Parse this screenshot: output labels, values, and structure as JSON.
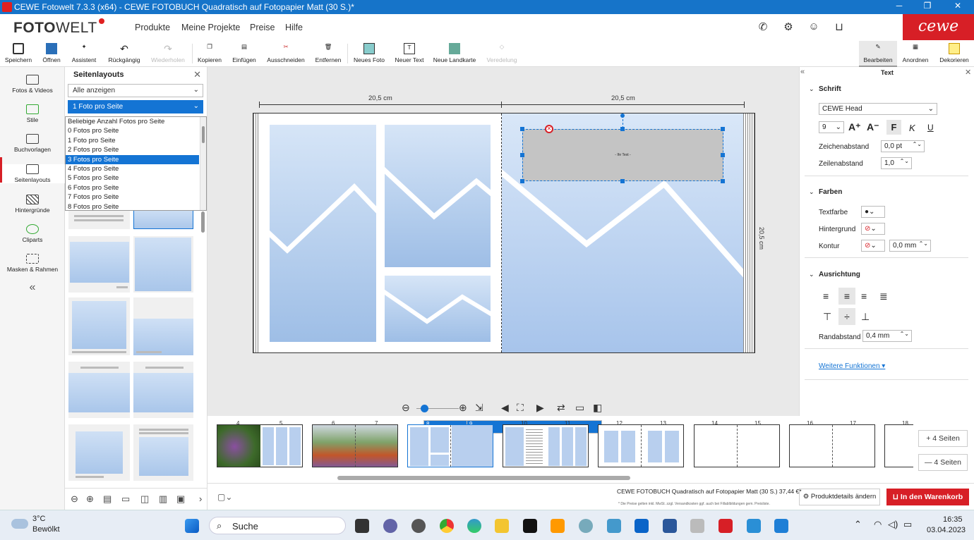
{
  "window": {
    "title": "CEWE Fotowelt 7.3.3 (x64) - CEWE FOTOBUCH Quadratisch auf Fotopapier Matt (30 S.)*"
  },
  "menubar": {
    "logo_a": "FOTO",
    "logo_b": "WELT",
    "items": [
      "Produkte",
      "Meine Projekte",
      "Preise",
      "Hilfe"
    ],
    "brand": "cewe"
  },
  "toolbar": {
    "items": [
      "Speichern",
      "Öffnen",
      "Assistent",
      "Rückgängig",
      "Wiederholen",
      "Kopieren",
      "Einfügen",
      "Ausschneiden",
      "Entfernen",
      "Neues Foto",
      "Neuer Text",
      "Neue Landkarte",
      "Veredelung"
    ],
    "right_tabs": [
      "Bearbeiten",
      "Anordnen",
      "Dekorieren"
    ]
  },
  "leftnav": [
    "Fotos & Videos",
    "Stile",
    "Buchvorlagen",
    "Seitenlayouts",
    "Hintergründe",
    "Cliparts",
    "Masken & Rahmen"
  ],
  "panel": {
    "title": "Seitenlayouts",
    "filter": "Alle anzeigen",
    "selected": "1 Foto pro Seite",
    "options": [
      "Beliebige Anzahl Fotos pro Seite",
      "0 Fotos pro Seite",
      "1 Foto pro Seite",
      "2 Fotos pro Seite",
      "3 Fotos pro Seite",
      "4 Fotos pro Seite",
      "5 Fotos pro Seite",
      "6 Fotos pro Seite",
      "7 Fotos pro Seite",
      "8 Fotos pro Seite"
    ],
    "highlighted_index": 4
  },
  "canvas": {
    "dim_left": "20,5 cm",
    "dim_right": "20,5 cm",
    "dim_height": "20,5 cm",
    "textbox_placeholder": "- Ihr Text -"
  },
  "pages": [
    "4",
    "5",
    "6",
    "7",
    "8",
    "9",
    "10",
    "11",
    "12",
    "13",
    "14",
    "15",
    "16",
    "17",
    "18"
  ],
  "page_buttons": {
    "add": "+ 4 Seiten",
    "remove": "— 4 Seiten"
  },
  "status": {
    "product": "CEWE FOTOBUCH Quadratisch auf Fotopapier Matt (30 S.) 37,44 €*",
    "note": "* Die Preise gelten inkl. MwSt. zzgl. Versandkosten ggf. auch bei Fillablbildungen gem. Preisliste.",
    "details": "Produktdetails ändern",
    "cart": "In den Warenkorb"
  },
  "rpanel": {
    "title": "Text",
    "schrift": "Schrift",
    "font": "CEWE Head",
    "size": "9",
    "bold": "F",
    "italic": "K",
    "underline": "U",
    "zeichenabstand_label": "Zeichenabstand",
    "zeichenabstand": "0,0 pt",
    "zeilenabstand_label": "Zeilenabstand",
    "zeilenabstand": "1,0",
    "farben": "Farben",
    "textfarbe": "Textfarbe",
    "hintergrund": "Hintergrund",
    "kontur": "Kontur",
    "kontur_val": "0,0 mm",
    "ausrichtung": "Ausrichtung",
    "randabstand_label": "Randabstand",
    "randabstand": "0,4 mm",
    "more": "Weitere Funktionen"
  },
  "taskbar": {
    "weather_temp": "3°C",
    "weather_desc": "Bewölkt",
    "search": "Suche",
    "time": "16:35",
    "date": "03.04.2023"
  },
  "colors": {
    "accent": "#1474d4",
    "brand": "#d71f26"
  }
}
